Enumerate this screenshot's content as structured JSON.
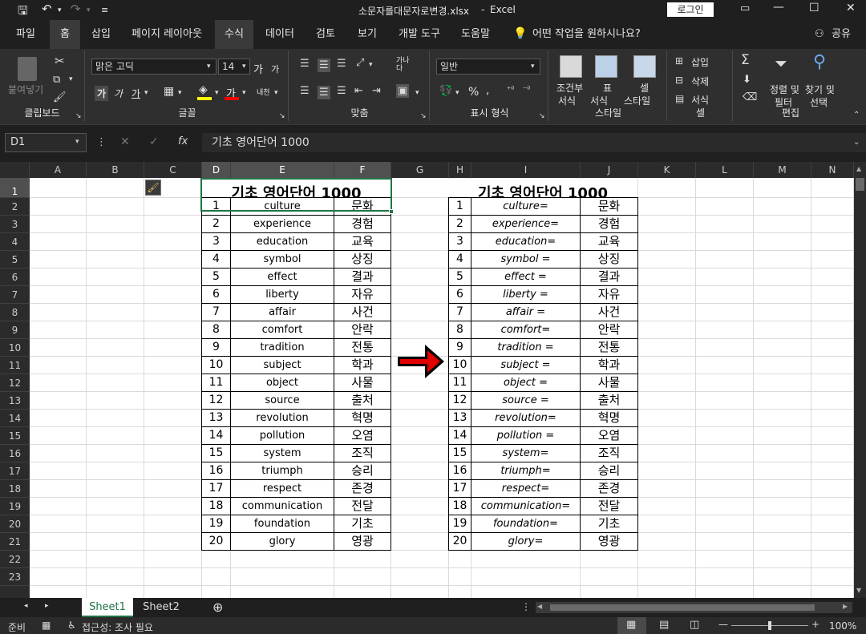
{
  "titlebar": {
    "filename": "소문자를대문자로변경.xlsx",
    "separator": "-",
    "app": "Excel",
    "login": "로그인"
  },
  "menu": [
    "파일",
    "홈",
    "삽입",
    "페이지 레이아웃",
    "수식",
    "데이터",
    "검토",
    "보기",
    "개발 도구",
    "도움말"
  ],
  "menu_active": "수식",
  "tell_me": "어떤 작업을 원하시나요?",
  "share": "공유",
  "ribbon": {
    "clipboard": {
      "label": "클립보드",
      "paste": "붙여넣기"
    },
    "font": {
      "label": "글꼴",
      "name": "맑은 고딕",
      "size": "14",
      "bold": "가",
      "italic": "가",
      "underline": "가",
      "grow": "가",
      "shrink": "가",
      "fontcolor": "가",
      "phonetic": "내천"
    },
    "align": {
      "label": "맞춤",
      "wrap": "가나다"
    },
    "number": {
      "label": "표시 형식",
      "format": "일반",
      "percent": "%"
    },
    "styles": {
      "label": "스타일",
      "cond_line1": "조건부",
      "cond_line2": "서식",
      "table_line1": "표",
      "table_line2": "서식",
      "cell_line1": "셀",
      "cell_line2": "스타일"
    },
    "cells": {
      "label": "셀",
      "insert": "삽입",
      "delete": "삭제",
      "format": "서식"
    },
    "edit": {
      "label": "편집",
      "sort_line1": "정렬 및",
      "sort_line2": "필터",
      "find_line1": "찾기 및",
      "find_line2": "선택"
    }
  },
  "formula_bar": {
    "name_box": "D1",
    "formula": "기초 영어단어 1000"
  },
  "columns": [
    "A",
    "B",
    "C",
    "D",
    "E",
    "F",
    "G",
    "H",
    "I",
    "J",
    "K",
    "L",
    "M",
    "N"
  ],
  "rows": [
    "1",
    "2",
    "3",
    "4",
    "5",
    "6",
    "7",
    "8",
    "9",
    "10",
    "11",
    "12",
    "13",
    "14",
    "15",
    "16",
    "17",
    "18",
    "19",
    "20",
    "21",
    "22",
    "23"
  ],
  "table_left": {
    "title": "기초 영어단어 1000",
    "rows": [
      {
        "n": "1",
        "en": "culture",
        "ko": "문화"
      },
      {
        "n": "2",
        "en": "experience",
        "ko": "경험"
      },
      {
        "n": "3",
        "en": "education",
        "ko": "교육"
      },
      {
        "n": "4",
        "en": "symbol",
        "ko": "상징"
      },
      {
        "n": "5",
        "en": "effect",
        "ko": "결과"
      },
      {
        "n": "6",
        "en": "liberty",
        "ko": "자유"
      },
      {
        "n": "7",
        "en": "affair",
        "ko": "사건"
      },
      {
        "n": "8",
        "en": "comfort",
        "ko": "안락"
      },
      {
        "n": "9",
        "en": "tradition",
        "ko": "전통"
      },
      {
        "n": "10",
        "en": "subject",
        "ko": "학과"
      },
      {
        "n": "11",
        "en": "object",
        "ko": "사물"
      },
      {
        "n": "12",
        "en": "source",
        "ko": "출처"
      },
      {
        "n": "13",
        "en": "revolution",
        "ko": "혁명"
      },
      {
        "n": "14",
        "en": "pollution",
        "ko": "오염"
      },
      {
        "n": "15",
        "en": "system",
        "ko": "조직"
      },
      {
        "n": "16",
        "en": "triumph",
        "ko": "승리"
      },
      {
        "n": "17",
        "en": "respect",
        "ko": "존경"
      },
      {
        "n": "18",
        "en": "communication",
        "ko": "전달"
      },
      {
        "n": "19",
        "en": "foundation",
        "ko": "기초"
      },
      {
        "n": "20",
        "en": "glory",
        "ko": "영광"
      }
    ]
  },
  "table_right": {
    "title": "기초 영어단어 1000",
    "rows": [
      {
        "n": "1",
        "en": "culture=",
        "ko": "문화"
      },
      {
        "n": "2",
        "en": "experience=",
        "ko": "경험"
      },
      {
        "n": "3",
        "en": "education=",
        "ko": "교육"
      },
      {
        "n": "4",
        "en": "symbol =",
        "ko": "상징"
      },
      {
        "n": "5",
        "en": "effect =",
        "ko": "결과"
      },
      {
        "n": "6",
        "en": "liberty =",
        "ko": "자유"
      },
      {
        "n": "7",
        "en": "affair =",
        "ko": "사건"
      },
      {
        "n": "8",
        "en": "comfort=",
        "ko": "안락"
      },
      {
        "n": "9",
        "en": "tradition =",
        "ko": "전통"
      },
      {
        "n": "10",
        "en": "subject =",
        "ko": "학과"
      },
      {
        "n": "11",
        "en": "object =",
        "ko": "사물"
      },
      {
        "n": "12",
        "en": "source =",
        "ko": "출처"
      },
      {
        "n": "13",
        "en": "revolution=",
        "ko": "혁명"
      },
      {
        "n": "14",
        "en": "pollution =",
        "ko": "오염"
      },
      {
        "n": "15",
        "en": "system=",
        "ko": "조직"
      },
      {
        "n": "16",
        "en": "triumph=",
        "ko": "승리"
      },
      {
        "n": "17",
        "en": "respect=",
        "ko": "존경"
      },
      {
        "n": "18",
        "en": "communication=",
        "ko": "전달"
      },
      {
        "n": "19",
        "en": "foundation=",
        "ko": "기초"
      },
      {
        "n": "20",
        "en": "glory=",
        "ko": "영광"
      }
    ]
  },
  "sheets": [
    "Sheet1",
    "Sheet2"
  ],
  "active_sheet": "Sheet1",
  "status": {
    "ready": "준비",
    "accessibility": "접근성: 조사 필요",
    "zoom": "100%",
    "zoom_level": 1.0
  },
  "colors": {
    "accent": "#217346",
    "arrow": "#e00000",
    "selection": "#217346"
  }
}
